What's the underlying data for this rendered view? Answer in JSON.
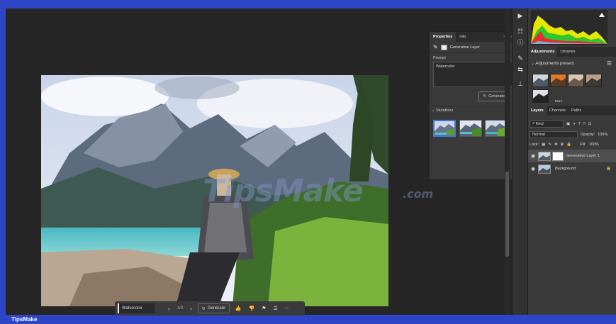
{
  "properties_panel": {
    "tabs": [
      "Properties",
      "Info"
    ],
    "tab_controls": ">>  |  ≡",
    "layer_type": "Generative Layer",
    "prompt_label": "Prompt",
    "prompt_value": "Watercolor",
    "generate_label": "Generate",
    "variations_label": "Variations"
  },
  "taskbar": {
    "prompt_value": "Watercolor",
    "page_indicator": "1/3",
    "generate_label": "Generate"
  },
  "adjustments_panel": {
    "tabs": [
      "Adjustments",
      "Libraries"
    ],
    "presets_title": "Adjustments presets",
    "more_label": "More"
  },
  "layers_panel": {
    "tabs": [
      "Layers",
      "Channels",
      "Paths"
    ],
    "filter_label": "Kind",
    "blend_mode": "Normal",
    "opacity_label": "Opacity:",
    "opacity_value": "100%",
    "lock_label": "Lock:",
    "fill_label": "Fill:",
    "fill_value": "100%",
    "layers": [
      {
        "name": "Generative Layer 1",
        "selected": true
      },
      {
        "name": "Background",
        "selected": false
      }
    ]
  },
  "watermark": {
    "text": "TipsMake",
    "suffix": ".com"
  },
  "footer": {
    "brand": "TipsMake"
  },
  "colors": {
    "frame_blue": "#2f45c8",
    "panel_bg": "#3a3a3a",
    "canvas_bg": "#262626",
    "accent_selection": "#3a78d8"
  }
}
